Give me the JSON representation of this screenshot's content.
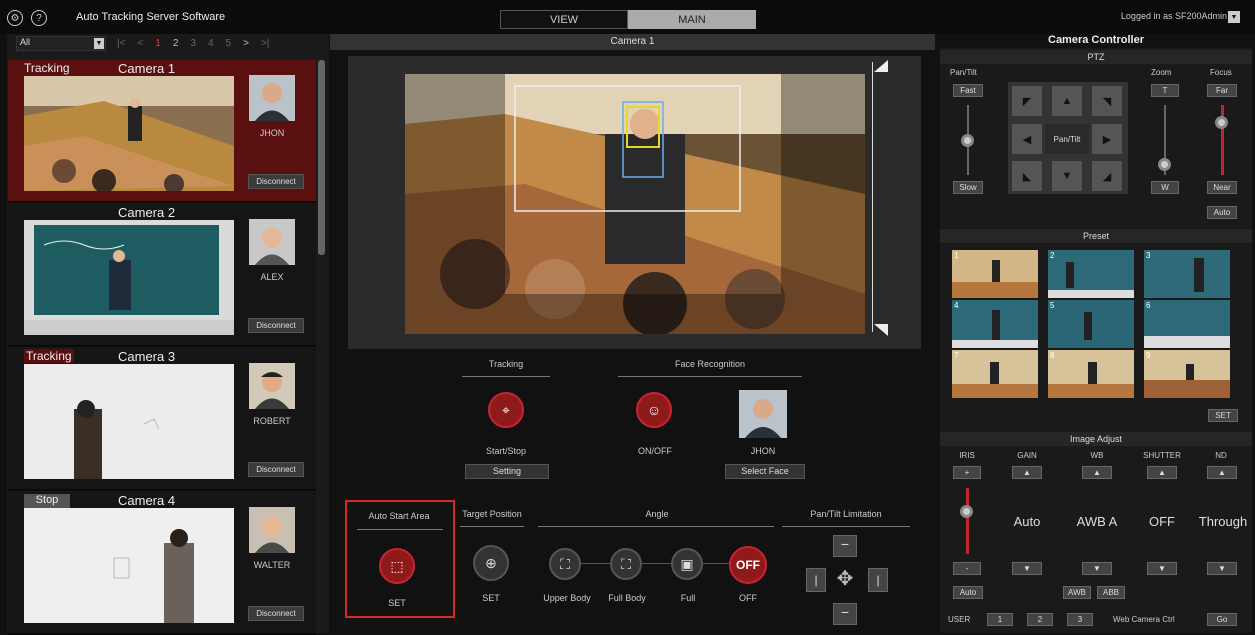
{
  "app": {
    "title": "Auto Tracking Server Software",
    "tabs": [
      "VIEW",
      "MAIN"
    ],
    "active_tab": "MAIN",
    "logged_in": "Logged in as SF200Admin"
  },
  "left": {
    "filter_value": "All",
    "pager": [
      "|<",
      "<",
      "1",
      "2",
      "3",
      "4",
      "5",
      ">",
      ">|"
    ],
    "cameras": [
      {
        "status": "Tracking",
        "name": "Camera 1",
        "face": "JHON",
        "button": "Disconnect"
      },
      {
        "status": "",
        "name": "Camera 2",
        "face": "ALEX",
        "button": "Disconnect"
      },
      {
        "status": "Tracking",
        "name": "Camera 3",
        "face": "ROBERT",
        "button": "Disconnect"
      },
      {
        "status": "Stop",
        "name": "Camera 4",
        "face": "WALTER",
        "button": "Disconnect"
      }
    ]
  },
  "center": {
    "camera_title": "Camera 1",
    "tracking": {
      "header": "Tracking",
      "start_label": "Start/Stop",
      "setting_button": "Setting"
    },
    "face": {
      "header": "Face Recognition",
      "on_off_label": "ON/OFF",
      "face_name": "JHON",
      "select_button": "Select Face"
    },
    "bottom": {
      "auto_start_area": {
        "header": "Auto Start Area",
        "label": "SET"
      },
      "target_position": {
        "header": "Target Position",
        "label": "SET"
      },
      "angle": {
        "header": "Angle",
        "options": [
          "Upper Body",
          "Full Body",
          "Full",
          "OFF"
        ],
        "off_text": "OFF"
      },
      "pan_tilt_limitation": {
        "header": "Pan/Tilt Limitation"
      }
    }
  },
  "right": {
    "title": "Camera Controller",
    "ptz": {
      "header": "PTZ",
      "pan_tilt": "Pan/Tilt",
      "fast": "Fast",
      "slow": "Slow",
      "center": "Pan/Tilt",
      "zoom": "Zoom",
      "zoom_t": "T",
      "zoom_w": "W",
      "focus": "Focus",
      "far": "Far",
      "near": "Near",
      "auto": "Auto"
    },
    "preset": {
      "header": "Preset",
      "numbers": [
        "1",
        "2",
        "3",
        "4",
        "5",
        "6",
        "7",
        "8",
        "9"
      ],
      "set": "SET"
    },
    "image_adjust": {
      "header": "Image Adjust",
      "columns": [
        "IRIS",
        "GAIN",
        "WB",
        "SHUTTER",
        "ND"
      ],
      "iris_plus": "+",
      "iris_minus": "-",
      "iris_auto": "Auto",
      "values": {
        "gain": "Auto",
        "wb": "AWB A",
        "shutter": "OFF",
        "nd": "Through"
      },
      "awb": "AWB",
      "abb": "ABB"
    },
    "user_bar": {
      "label": "USER",
      "buttons": [
        "1",
        "2",
        "3"
      ],
      "web_ctrl": "Web Camera Ctrl",
      "go": "Go"
    }
  },
  "colors": {
    "accent_red": "#c0262c",
    "tracking_bg": "#5b1010",
    "panel": "#1a1a1a"
  }
}
